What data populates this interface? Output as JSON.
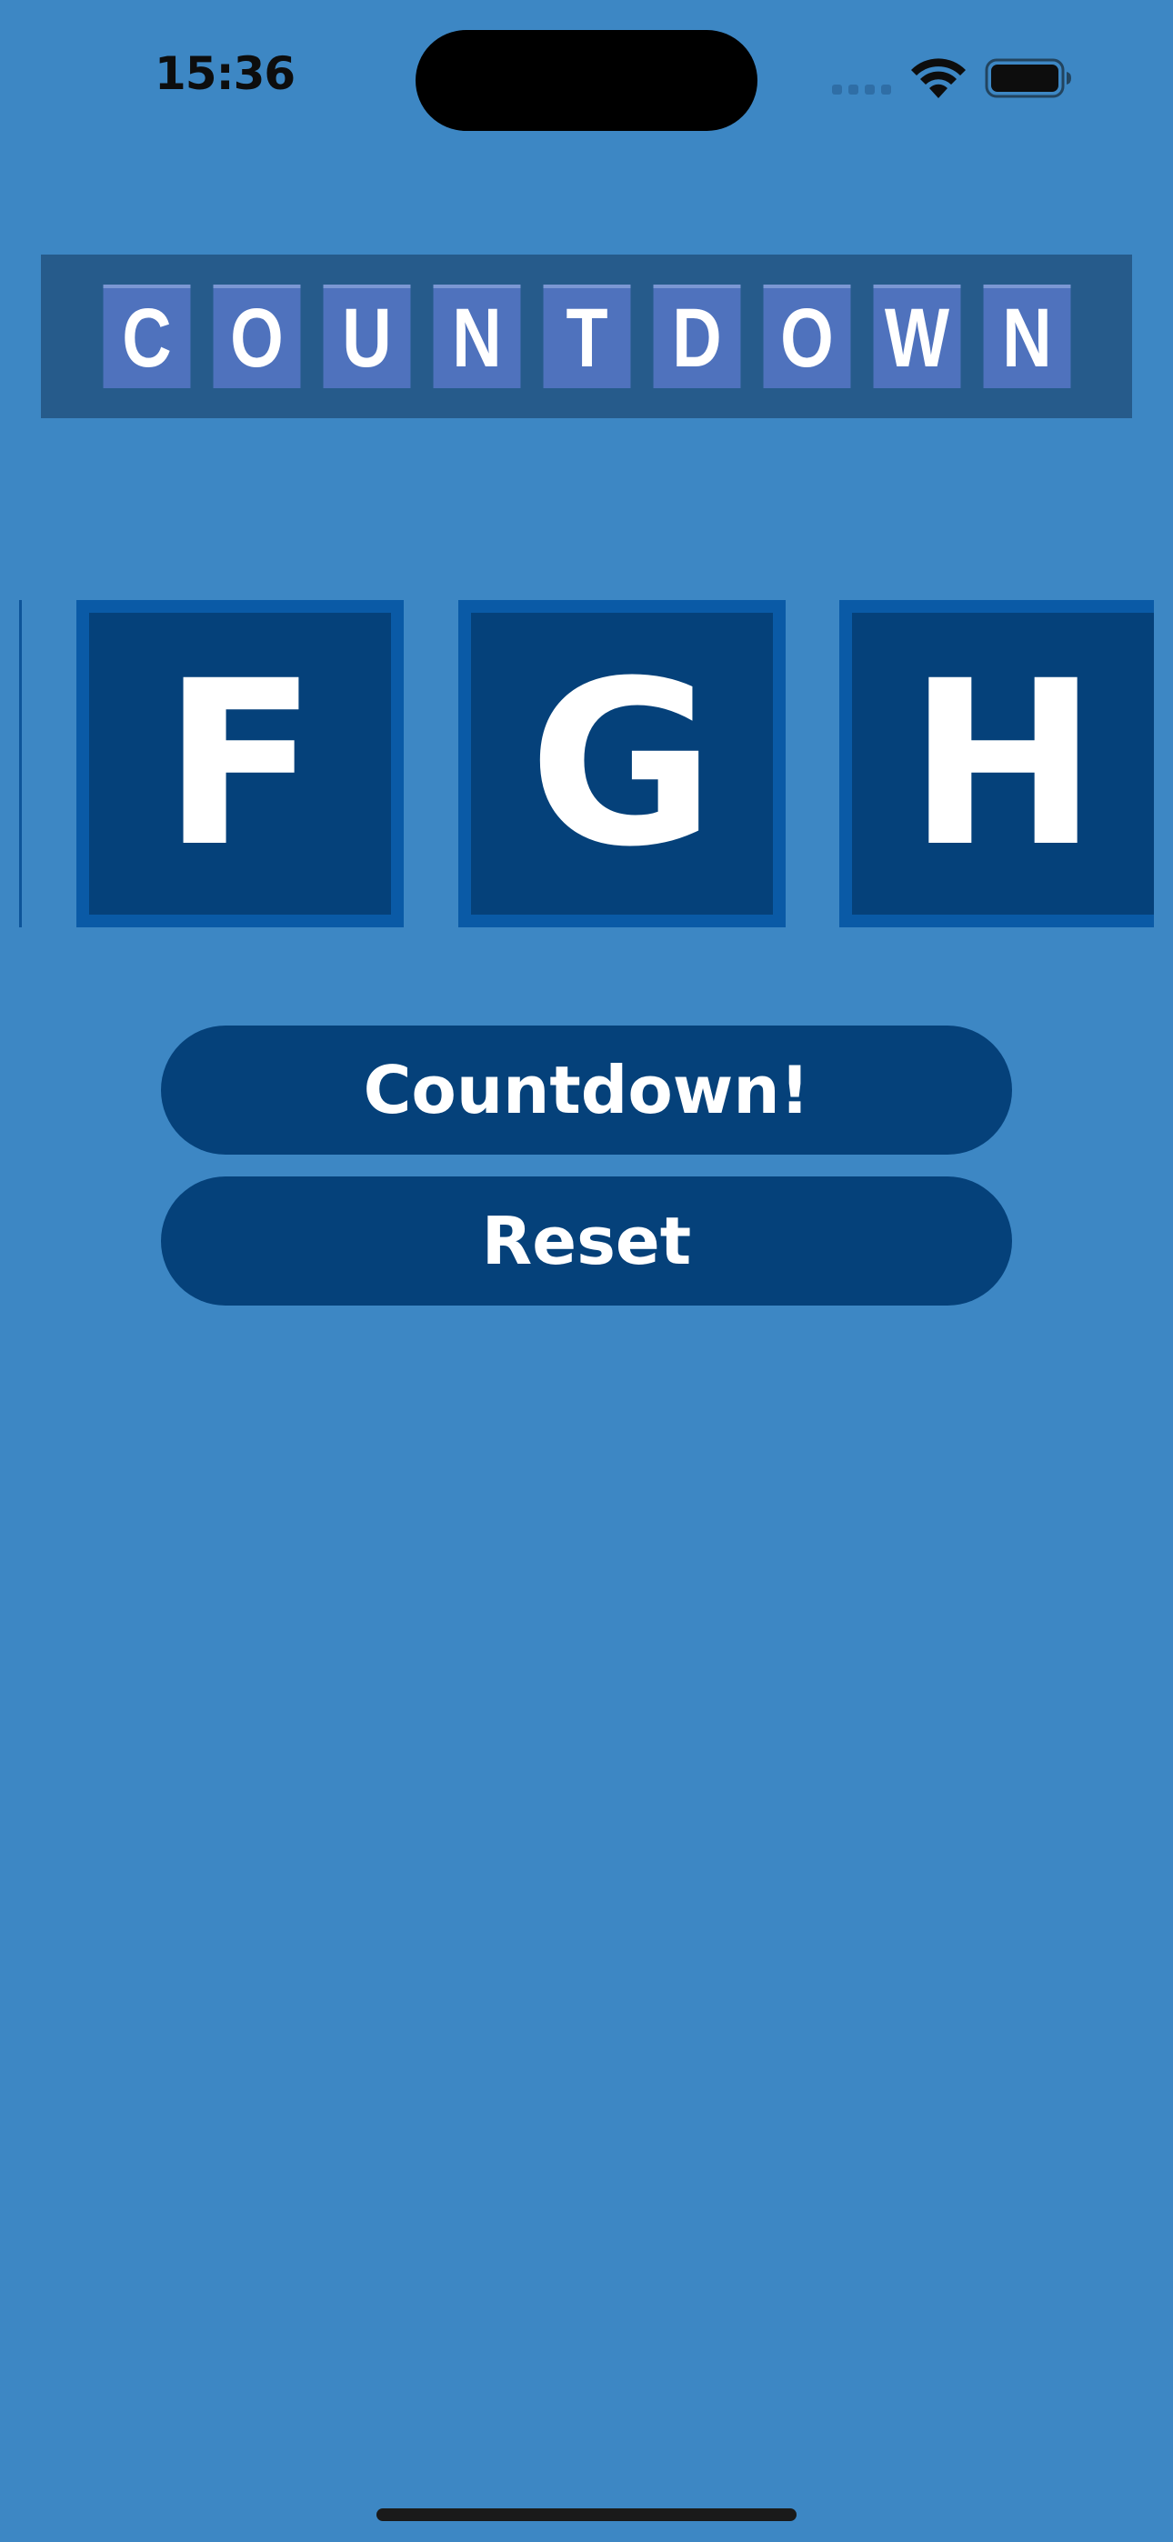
{
  "status_bar": {
    "time": "15:36",
    "icons": [
      "cell-signal-icon",
      "wifi-icon",
      "battery-icon"
    ]
  },
  "title": {
    "letters": [
      "C",
      "O",
      "U",
      "N",
      "T",
      "D",
      "O",
      "W",
      "N"
    ]
  },
  "tiles": {
    "letters": [
      "F",
      "G",
      "H"
    ]
  },
  "buttons": {
    "countdown_label": "Countdown!",
    "reset_label": "Reset"
  },
  "colors": {
    "background": "#3d87c4",
    "tile": "#05417a",
    "tile_border": "#0a5aa6",
    "title_banner": "#265b8b",
    "title_tile": "#4f72bd",
    "button": "#05417a",
    "text": "#ffffff"
  }
}
